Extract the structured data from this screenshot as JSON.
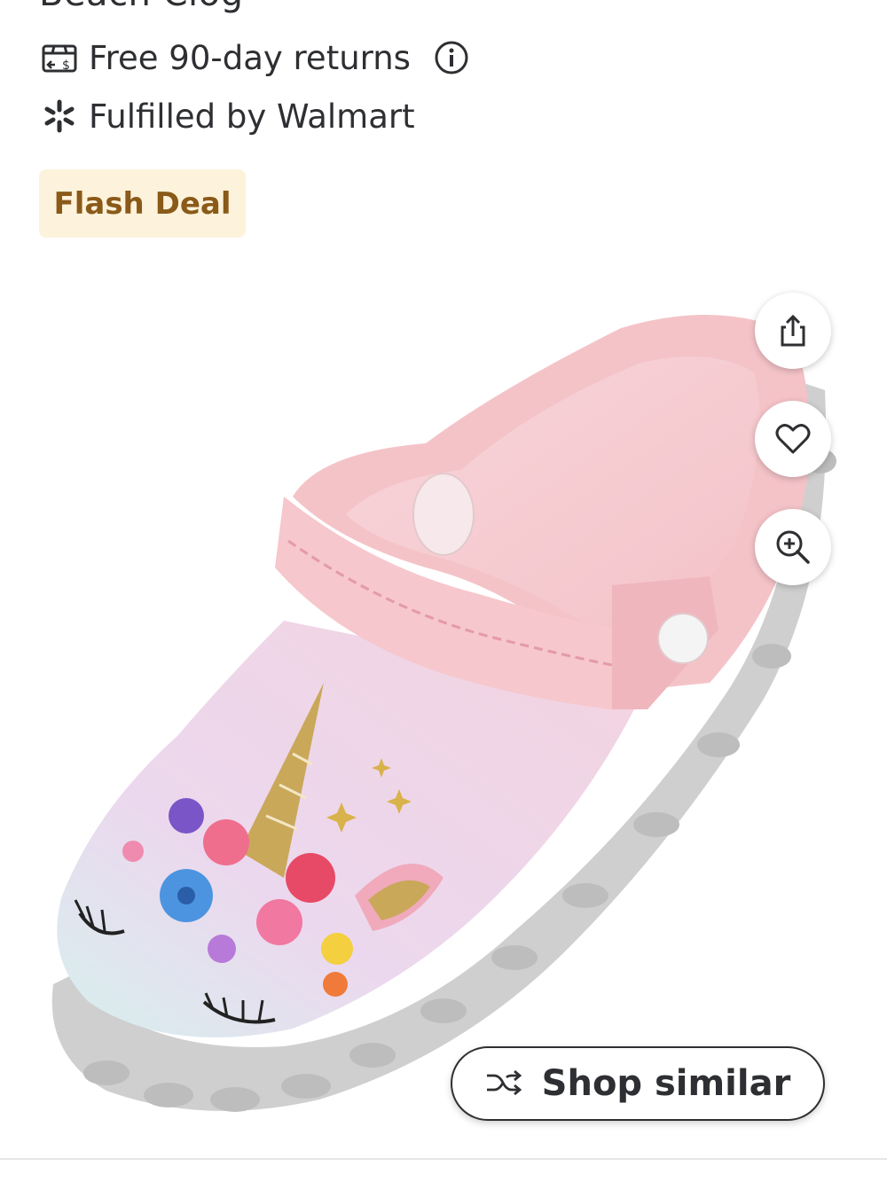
{
  "product": {
    "title_fragment": "Beach Clog",
    "returns_text": "Free 90-day returns",
    "fulfilled_text": "Fulfilled by Walmart",
    "badge_text": "Flash Deal"
  },
  "actions": {
    "share_icon": "share-icon",
    "favorite_icon": "heart-icon",
    "zoom_icon": "zoom-in-icon",
    "shop_similar_label": "Shop similar",
    "shop_similar_icon": "shuffle-icon"
  },
  "colors": {
    "text": "#2e2f32",
    "badge_bg": "#fdf3dc",
    "badge_text": "#8a5a19",
    "clog_pink": "#f5c6cc",
    "sole_gray": "#c9c9c9"
  }
}
